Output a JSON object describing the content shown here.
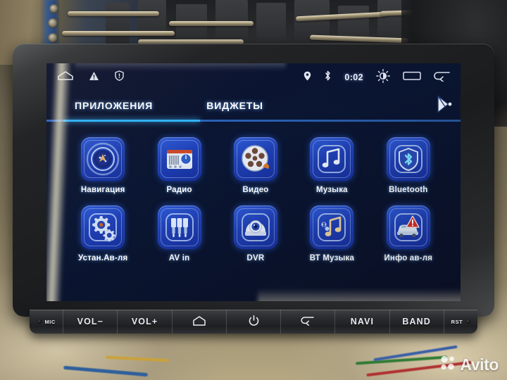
{
  "photo": {
    "watermark": "Avito",
    "watermark_logo_icon": "avito-dots-logo-icon"
  },
  "device": {
    "statusbar": {
      "left_icons": [
        {
          "name": "home-outline-icon",
          "label": "home"
        },
        {
          "name": "warning-triangle-icon",
          "label": "warning"
        },
        {
          "name": "shield-exclamation-icon",
          "label": "security-alert"
        }
      ],
      "right_icons": [
        {
          "name": "location-pin-icon",
          "label": "location"
        },
        {
          "name": "bluetooth-icon",
          "label": "bluetooth"
        }
      ],
      "clock": "0:02",
      "nav_icons": [
        {
          "name": "brightness-icon",
          "label": "brightness"
        },
        {
          "name": "recent-apps-icon",
          "label": "recent apps"
        },
        {
          "name": "back-arrow-icon",
          "label": "back"
        }
      ]
    },
    "tabs": {
      "items": [
        {
          "label": "ПРИЛОЖЕНИЯ",
          "active": true
        },
        {
          "label": "ВИДЖЕТЫ",
          "active": false
        }
      ],
      "playstore_icon": "play-store-icon",
      "active_underline_color": "#2fb4ff"
    },
    "apps": [
      {
        "label": "Навигация",
        "icon": "navigation-compass-icon"
      },
      {
        "label": "Радио",
        "icon": "radio-icon"
      },
      {
        "label": "Видео",
        "icon": "film-reel-icon"
      },
      {
        "label": "Музыка",
        "icon": "music-note-icon"
      },
      {
        "label": "Bluetooth",
        "icon": "bluetooth-shield-icon"
      },
      {
        "label": "Устан.Ав-ля",
        "icon": "gears-settings-icon"
      },
      {
        "label": "AV in",
        "icon": "rca-plugs-icon"
      },
      {
        "label": "DVR",
        "icon": "dome-camera-icon"
      },
      {
        "label": "ВТ Музыка",
        "icon": "bluetooth-music-icon"
      },
      {
        "label": "Инфо ав-ля",
        "icon": "car-warning-icon"
      }
    ],
    "hardware_buttons": [
      {
        "label": "MIC",
        "icon": "mic-hole-icon",
        "style": "narrow"
      },
      {
        "label": "VOL−",
        "icon": "",
        "style": ""
      },
      {
        "label": "VOL+",
        "icon": "",
        "style": ""
      },
      {
        "label": "",
        "icon": "home-icon",
        "style": ""
      },
      {
        "label": "",
        "icon": "power-icon",
        "style": ""
      },
      {
        "label": "",
        "icon": "back-arrow-icon",
        "style": ""
      },
      {
        "label": "NAVI",
        "icon": "",
        "style": ""
      },
      {
        "label": "BAND",
        "icon": "",
        "style": ""
      },
      {
        "label": "RST",
        "icon": "reset-hole-icon",
        "style": "narrow"
      }
    ],
    "colors": {
      "tile_blue": "#1f3fb4",
      "accent_cyan": "#2fb4ff",
      "screen_bg": "#0b1128"
    }
  }
}
